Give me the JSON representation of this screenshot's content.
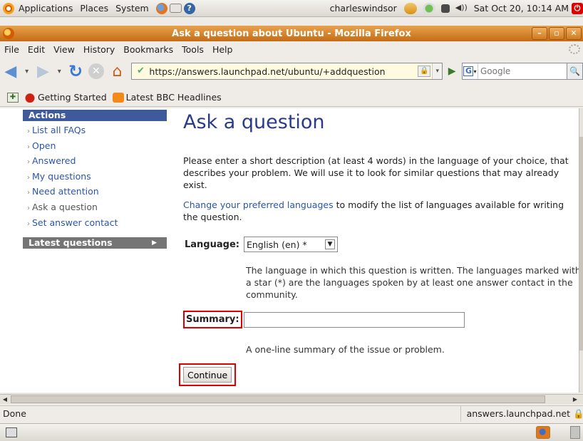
{
  "gnome_panel": {
    "menus": [
      "Applications",
      "Places",
      "System"
    ],
    "user": "charleswindsor",
    "clock": "Sat Oct 20, 10:14 AM"
  },
  "window": {
    "title": "Ask a question about Ubuntu - Mozilla Firefox"
  },
  "menubar": {
    "items": [
      "File",
      "Edit",
      "View",
      "History",
      "Bookmarks",
      "Tools",
      "Help"
    ]
  },
  "navbar": {
    "url": "https://answers.launchpad.net/ubuntu/+addquestion",
    "search_placeholder": "Google"
  },
  "bookmarks": {
    "items": [
      "Getting Started",
      "Latest BBC Headlines"
    ]
  },
  "sidebar": {
    "actions_title": "Actions",
    "links": [
      "List all FAQs",
      "Open",
      "Answered",
      "My questions",
      "Need attention",
      "Ask a question",
      "Set answer contact"
    ],
    "latest_title": "Latest questions"
  },
  "main": {
    "heading": "Ask a question",
    "intro": "Please enter a short description (at least 4 words) in the language of your choice, that describes your problem. We will use it to look for similar questions that may already exist.",
    "lang_link": "Change your preferred languages",
    "lang_link_rest": " to modify the list of languages available for writing the question.",
    "language_label": "Language:",
    "language_value": "English (en) *",
    "language_help": "The language in which this question is written. The languages marked with a star (*) are the languages spoken by at least one answer contact in the community.",
    "summary_label": "Summary:",
    "summary_value": "",
    "summary_help": "A one-line summary of the issue or problem.",
    "continue_label": "Continue"
  },
  "statusbar": {
    "status": "Done",
    "domain": "answers.launchpad.net"
  }
}
